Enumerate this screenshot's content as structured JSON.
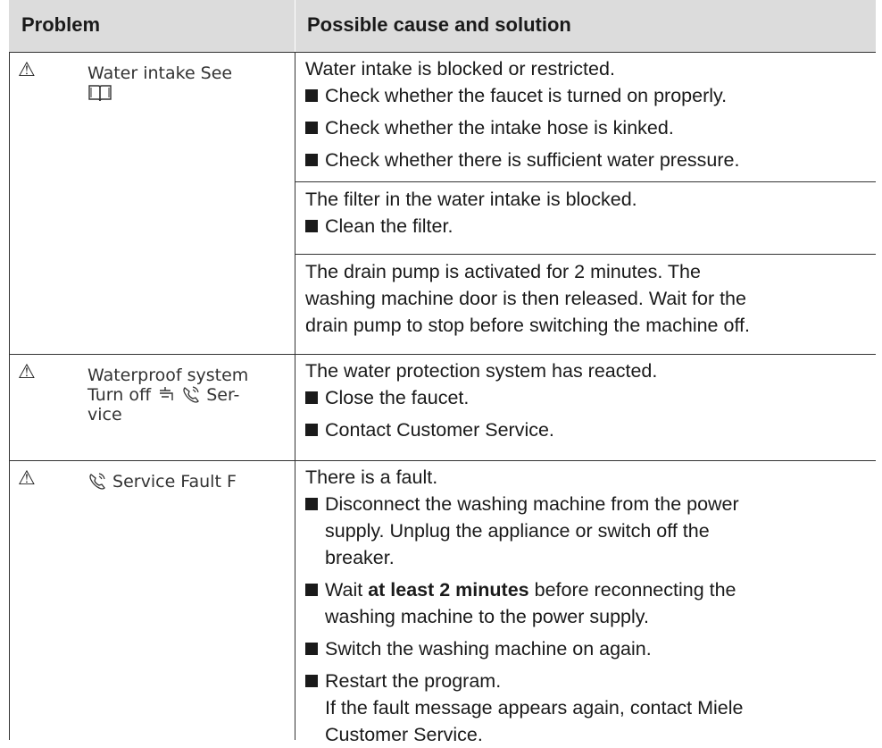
{
  "header": {
    "col_problem": "Problem",
    "col_solution": "Possible cause and solution"
  },
  "rows": [
    {
      "symbol": "⚠",
      "message": "Water intake See",
      "message_icon": "book-icon",
      "blocks": [
        {
          "intro": "Water intake is blocked or restricted.",
          "bullets": [
            "Check whether the faucet is turned on properly.",
            "Check whether the intake hose is kinked.",
            "Check whether there is sufficient water pressure."
          ]
        },
        {
          "intro": "The filter in the water intake is blocked.",
          "bullets": [
            "Clean the filter."
          ]
        },
        {
          "lines": [
            "The drain pump is activated for 2 minutes. The",
            "washing machine door is then released. Wait for the",
            "drain pump to stop before switching the machine off."
          ]
        }
      ]
    },
    {
      "symbol": "⚠",
      "message_lines": [
        "Waterproof system",
        "Turn off",
        "Ser-",
        "vice"
      ],
      "message_icons": [
        "faucet-icon",
        "phone-service-icon"
      ],
      "blocks": [
        {
          "intro": "The water protection system has reacted.",
          "bullets": [
            "Close the faucet.",
            "Contact Customer Service."
          ]
        }
      ]
    },
    {
      "symbol": "⚠",
      "message": "Service Fault F",
      "message_icon": "phone-service-icon",
      "blocks": [
        {
          "intro": "There is a fault.",
          "bullet1": [
            "Disconnect the washing machine from the power",
            "supply. Unplug the appliance or switch off the",
            "breaker."
          ],
          "bullet2": {
            "before": "Wait",
            "bold": "at least 2 minutes",
            "after": "before reconnecting the",
            "line2": "washing machine to the power supply."
          },
          "bullet3": "Switch the washing machine on again.",
          "bullet4": [
            "Restart the program.",
            "If the fault message appears again, contact Miele",
            "Customer Service."
          ]
        }
      ]
    }
  ]
}
